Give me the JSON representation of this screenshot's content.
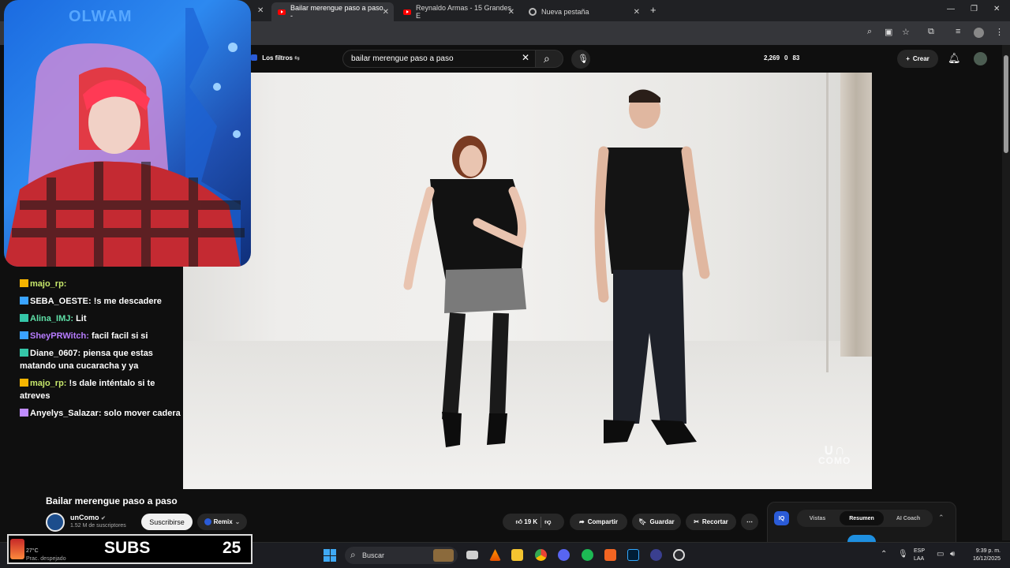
{
  "browser": {
    "tabs": [
      {
        "label": "Bailar merengue paso a paso -"
      },
      {
        "label": "Reynaldo Armas - 15 Grandes E"
      },
      {
        "label": "Nueva pestaña"
      }
    ],
    "new_tab": "+"
  },
  "youtube": {
    "filters_label": "Los filtros",
    "search_value": "bailar merengue paso a paso",
    "stats": {
      "views": "2,269",
      "v2": "0",
      "v3": "83"
    },
    "create_label": "Crear"
  },
  "stream": {
    "cam_logo": "OLWAM",
    "chat": [
      {
        "user": "majo_rp:",
        "text": "",
        "color": "#c7e86b"
      },
      {
        "user": "SEBA_OESTE:",
        "text": " !s me descadere",
        "color": "#ffffff"
      },
      {
        "user": "Alina_IMJ:",
        "text": " Lit",
        "color": "#5fe0a8"
      },
      {
        "user": "SheyPRWitch:",
        "text": " facil facil si si",
        "color": "#b77cff"
      },
      {
        "user": "Diane_0607:",
        "text": " piensa que estas matando una cucaracha y ya",
        "color": "#ffffff"
      },
      {
        "user": "majo_rp:",
        "text": " !s dale inténtalo si te atreves",
        "color": "#c7e86b"
      },
      {
        "user": "Anyelys_Salazar:",
        "text": " solo mover cadera",
        "color": "#ffffff"
      }
    ],
    "subs_label": "SUBS",
    "subs_count": "25",
    "weather_temp": "27°C",
    "weather_desc": "Prac. despejado"
  },
  "video": {
    "watermark": "COMO",
    "title": "Bailar merengue paso a paso",
    "channel": "unComo",
    "subscribers": "1.52 M de suscriptores",
    "subscribe_label": "Suscribirse",
    "remix_label": "Remix",
    "likes": "19 K",
    "share_label": "Compartir",
    "save_label": "Guardar",
    "clip_label": "Recortar"
  },
  "side_panel": {
    "tabs": [
      "Vistas",
      "Resumen",
      "AI Coach"
    ],
    "active_tab": "Resumen",
    "badge": "IQ"
  },
  "taskbar": {
    "search_label": "Buscar",
    "lang_top": "ESP",
    "lang_bottom": "LAA",
    "time": "9:39 p. m.",
    "date": "16/12/2025"
  }
}
